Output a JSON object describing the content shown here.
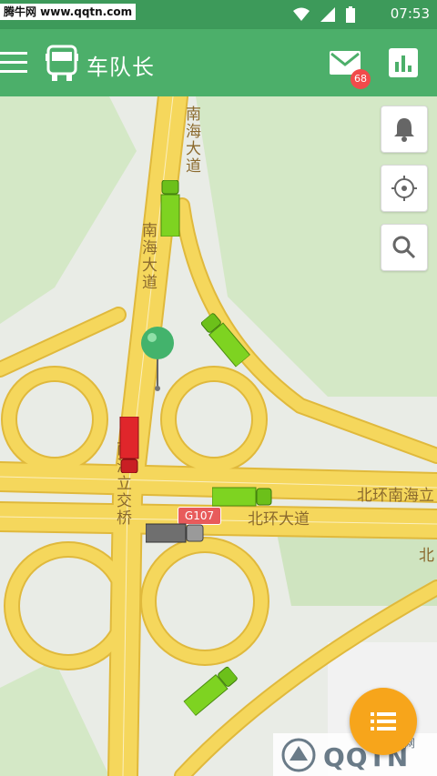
{
  "status_bar": {
    "watermark": "腾牛网 www.qqtn.com",
    "time": "07:53"
  },
  "app_bar": {
    "title": "车队长",
    "badge_count": "68"
  },
  "map": {
    "labels": {
      "road_a": "南海大道",
      "road_b": "南海大道",
      "interchange": "南海立交桥",
      "beihuan_nanhai": "北环南海立",
      "beihuan": "北环大道",
      "bei_partial": "北",
      "route": "G107"
    }
  },
  "watermark_bottom": {
    "text": "QQTN",
    "sub": "腾牛网"
  },
  "colors": {
    "accent": "#4caf6a",
    "fab": "#f7a51b",
    "road": "#f5d75c",
    "badge": "#f14b4b"
  }
}
